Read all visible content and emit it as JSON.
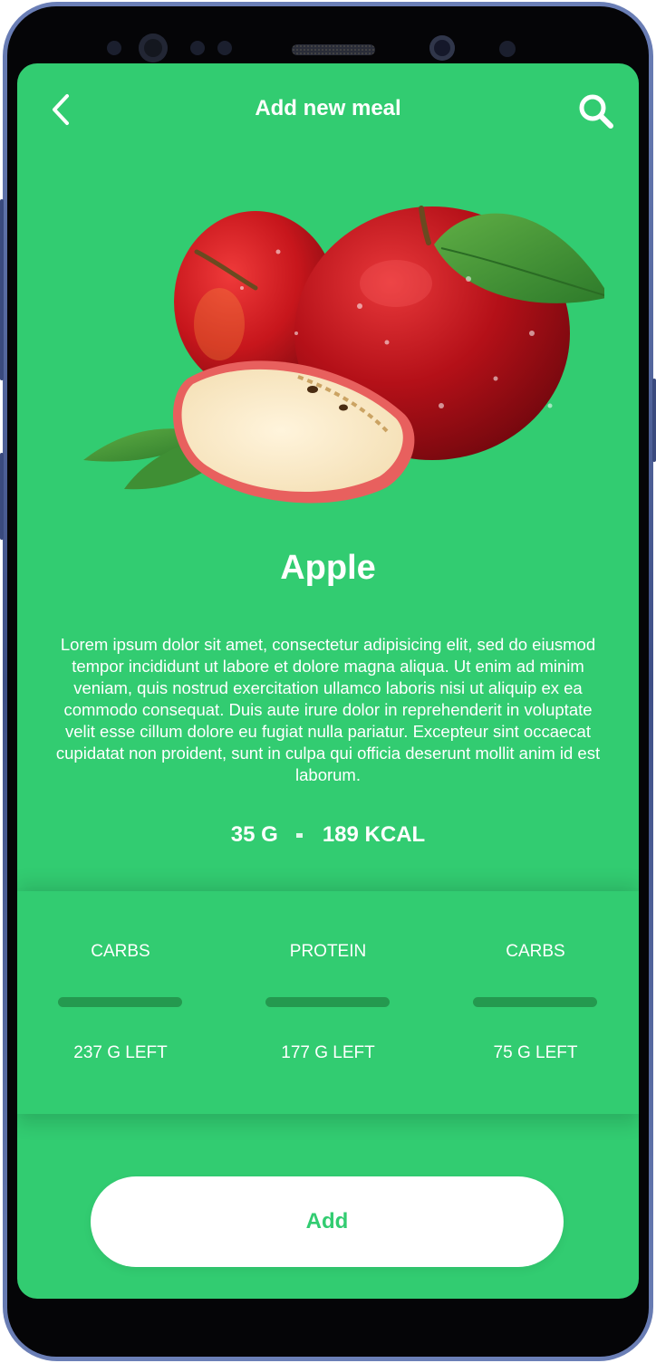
{
  "header": {
    "title": "Add new meal",
    "back_icon": "chevron-left-icon",
    "search_icon": "search-icon"
  },
  "food": {
    "image": "apple-image",
    "name": "Apple",
    "description": "Lorem ipsum dolor sit amet, consectetur adipisicing elit, sed do eiusmod tempor incididunt ut labore et dolore magna aliqua. Ut enim ad minim veniam, quis nostrud exercitation ullamco laboris nisi ut aliquip ex ea commodo consequat. Duis aute irure dolor in reprehenderit in voluptate velit esse cillum dolore eu fugiat nulla pariatur. Excepteur sint occaecat cupidatat non proident, sunt in culpa qui officia deserunt mollit anim id est laborum.",
    "weight": "35 G",
    "calories": "189 KCAL"
  },
  "macros": [
    {
      "label": "CARBS",
      "left": "237 G LEFT",
      "progress": 0
    },
    {
      "label": "PROTEIN",
      "left": "177 G LEFT",
      "progress": 0
    },
    {
      "label": "CARBS",
      "left": "75 G LEFT",
      "progress": 0
    }
  ],
  "actions": {
    "add_label": "Add"
  },
  "colors": {
    "accent": "#32cc71",
    "bar_track": "#24994f",
    "text": "#ffffff"
  }
}
